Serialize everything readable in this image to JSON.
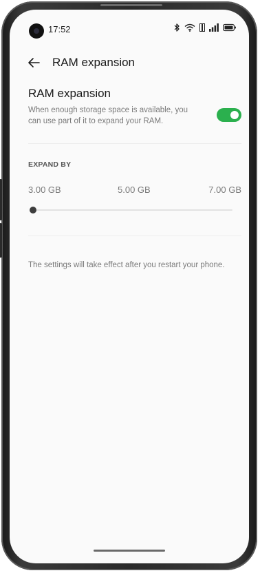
{
  "status_bar": {
    "time": "17:52",
    "icons": [
      "bluetooth-icon",
      "wifi-icon",
      "hd-icon",
      "signal-icon",
      "battery-icon"
    ]
  },
  "header": {
    "back_icon": "arrow-left-icon",
    "title": "RAM expansion"
  },
  "ram_setting": {
    "title": "RAM expansion",
    "description": "When enough storage space is available, you can use part of it to expand your RAM.",
    "toggle_on": true
  },
  "expand_section": {
    "header": "EXPAND BY",
    "options": [
      "3.00 GB",
      "5.00 GB",
      "7.00 GB"
    ],
    "selected": "3.00 GB"
  },
  "footnote": "The settings will take effect after you restart your phone.",
  "colors": {
    "accent": "#2bb04e",
    "background": "#fafafa",
    "slider_thumb": "#3d3d3d"
  }
}
